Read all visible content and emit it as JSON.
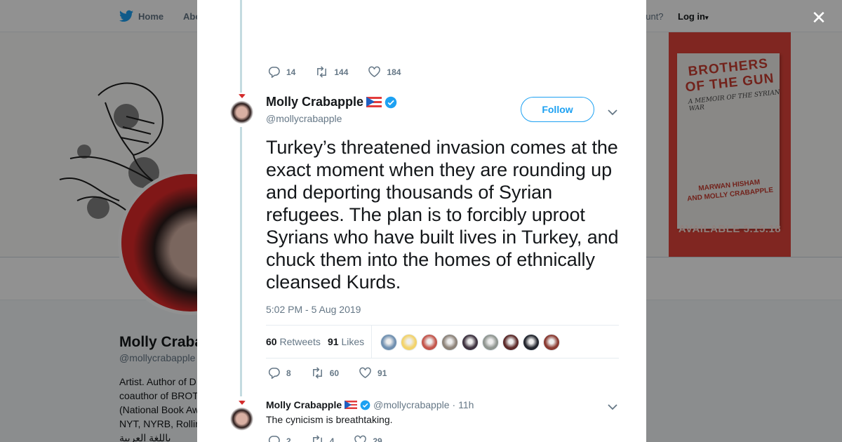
{
  "nav": {
    "home_label": "Home",
    "about_label": "Abo",
    "account_prompt": "ccount?",
    "login_label": "Log in",
    "caret": "▾"
  },
  "banner": {
    "book_title": "BROTHERS OF THE GUN",
    "book_subtitle": "A MEMOIR OF THE SYRIAN WAR",
    "book_author_1": "MARWAN HISHAM",
    "book_author_2": "AND MOLLY CRABAPPLE",
    "book_available": "AVAILABLE 5.15.18"
  },
  "profile": {
    "name": "Molly Craba",
    "handle": "@mollycrabapple",
    "bio_lines": [
      "Artist. Author of D",
      "coauthor of BROT",
      "(National Book Aw",
      "NYT, NYRB, Rollin",
      "باللغة العربية"
    ]
  },
  "modal": {
    "close_glyph": "✕",
    "prev_actions": {
      "replies": "14",
      "retweets": "144",
      "likes": "184"
    },
    "tweet": {
      "author_name": "Molly Crabapple",
      "author_handle": "@mollycrabapple",
      "follow_label": "Follow",
      "text": "Turkey’s threatened invasion comes at the exact moment when they are rounding up and deporting thousands of Syrian refugees. The plan is to forcibly uproot Syrians who have built lives in Turkey, and chuck them into the homes of ethnically cleansed Kurds.",
      "timestamp": "5:02 PM - 5 Aug 2019",
      "retweets_count": "60",
      "retweets_label": "Retweets",
      "likes_count": "91",
      "likes_label": "Likes",
      "likers": [
        {
          "name": "liker-1",
          "color": "#6f8fb0"
        },
        {
          "name": "liker-2",
          "color": "#f3d36b"
        },
        {
          "name": "liker-3",
          "color": "#c4564c"
        },
        {
          "name": "liker-4",
          "color": "#8d8379"
        },
        {
          "name": "liker-5",
          "color": "#3f3340"
        },
        {
          "name": "liker-6",
          "color": "#8f9590"
        },
        {
          "name": "liker-7",
          "color": "#5d2b2a"
        },
        {
          "name": "liker-8",
          "color": "#23262e"
        },
        {
          "name": "liker-9",
          "color": "#8a3a31"
        }
      ],
      "actions": {
        "replies": "8",
        "retweets": "60",
        "likes": "91"
      }
    },
    "reply": {
      "author_name": "Molly Crabapple",
      "author_handle": "@mollycrabapple",
      "time": "· 11h",
      "text": "The cynicism is breathtaking.",
      "actions": {
        "replies": "2",
        "retweets": "4",
        "likes": "29"
      }
    }
  },
  "colors": {
    "twitter_blue": "#1da1f2",
    "muted_text": "#657786",
    "book_red": "#e1443a"
  }
}
